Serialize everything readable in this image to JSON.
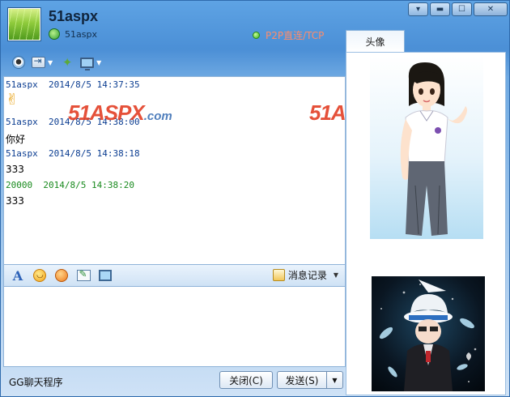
{
  "header": {
    "nickname": "51aspx",
    "signature": "51aspx",
    "connection_status": "P2P直连/TCP"
  },
  "window_controls": {
    "menu": "▾",
    "minimize": "▬",
    "maximize": "☐",
    "close": "✕"
  },
  "tabs": {
    "avatar_tab": "头像"
  },
  "watermark": {
    "brand": "51ASPX",
    "suffix": ".com"
  },
  "messages": [
    {
      "sender": "51aspx",
      "time": "2014/8/5 14:37:35",
      "body": "✌",
      "self": false
    },
    {
      "sender": "51aspx",
      "time": "2014/8/5 14:38:00",
      "body": "你好",
      "self": false
    },
    {
      "sender": "51aspx",
      "time": "2014/8/5 14:38:18",
      "body": "333",
      "self": false
    },
    {
      "sender": "20000",
      "time": "2014/8/5 14:38:20",
      "body": "333",
      "self": true
    }
  ],
  "format_bar": {
    "history_label": "消息记录"
  },
  "footer": {
    "app_label": "GG聊天程序",
    "close_button": "关闭(C)",
    "send_button": "发送(S)"
  },
  "colors": {
    "incoming_header": "#0b3d91",
    "outgoing_header": "#198a1e",
    "watermark": "#e23a1f",
    "title_bar": "#4b8fd6"
  }
}
